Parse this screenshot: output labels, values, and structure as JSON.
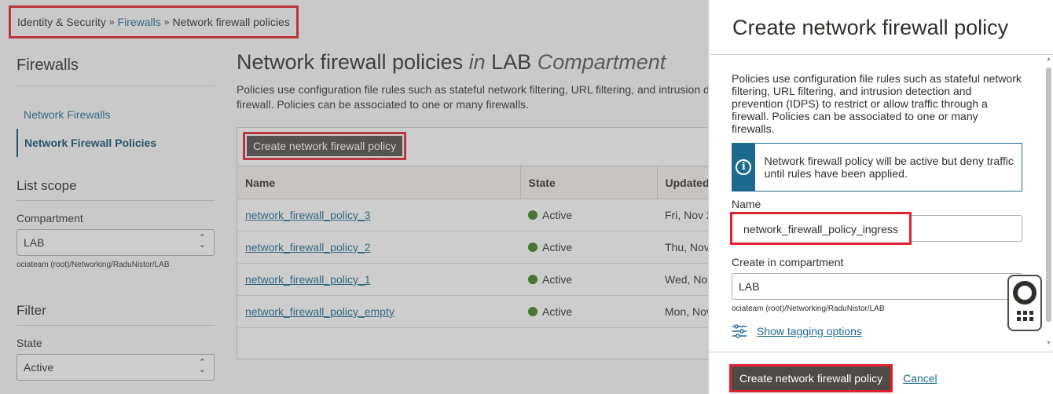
{
  "breadcrumb": {
    "items": [
      "Identity & Security",
      "Firewalls",
      "Network firewall policies"
    ],
    "separator": "»"
  },
  "sidebar": {
    "title": "Firewalls",
    "nav": [
      {
        "label": "Network Firewalls",
        "active": false
      },
      {
        "label": "Network Firewall Policies",
        "active": true
      }
    ],
    "list_scope": {
      "title": "List scope",
      "compartment_label": "Compartment",
      "compartment_value": "LAB",
      "compartment_path": "ociateam (root)/Networking/RaduNistor/LAB"
    },
    "filter": {
      "title": "Filter",
      "state_label": "State",
      "state_value": "Active"
    }
  },
  "main": {
    "title_prefix": "Network firewall policies",
    "title_in": "in",
    "title_compartment": "LAB",
    "title_suffix": "Compartment",
    "description_line1": "Policies use configuration file rules such as stateful network filtering, URL filtering, and intrusion d",
    "description_line2": "firewall. Policies can be associated to one or many firewalls.",
    "create_button": "Create network firewall policy",
    "table": {
      "columns": [
        "Name",
        "State",
        "Updated"
      ],
      "rows": [
        {
          "name": "network_firewall_policy_3",
          "state": "Active",
          "updated": "Fri, Nov 2"
        },
        {
          "name": "network_firewall_policy_2",
          "state": "Active",
          "updated": "Thu, Nov"
        },
        {
          "name": "network_firewall_policy_1",
          "state": "Active",
          "updated": "Wed, No"
        },
        {
          "name": "network_firewall_policy_empty",
          "state": "Active",
          "updated": "Mon, Nov"
        }
      ]
    }
  },
  "drawer": {
    "title": "Create network firewall policy",
    "intro": "Policies use configuration file rules such as stateful network filtering, URL filtering, and intrusion detection and prevention (IDPS) to restrict or allow traffic through a firewall. Policies can be associated to one or many firewalls.",
    "info": "Network firewall policy will be active but deny traffic until rules have been applied.",
    "name_label": "Name",
    "name_value": "network_firewall_policy_ingress",
    "compartment_label": "Create in compartment",
    "compartment_value": "LAB",
    "compartment_path": "ociateam (root)/Networking/RaduNistor/LAB",
    "tagging_link": "Show tagging options",
    "submit_button": "Create network firewall policy",
    "cancel_link": "Cancel"
  },
  "colors": {
    "accent": "#1e6a8f",
    "highlight": "#e3212f",
    "active_dot": "#3f7d20",
    "primary_button": "#4e4a46"
  },
  "icons": [
    "chevron-updown-icon",
    "info-icon",
    "sliders-icon",
    "help-lifebuoy-icon",
    "grid-icon"
  ]
}
